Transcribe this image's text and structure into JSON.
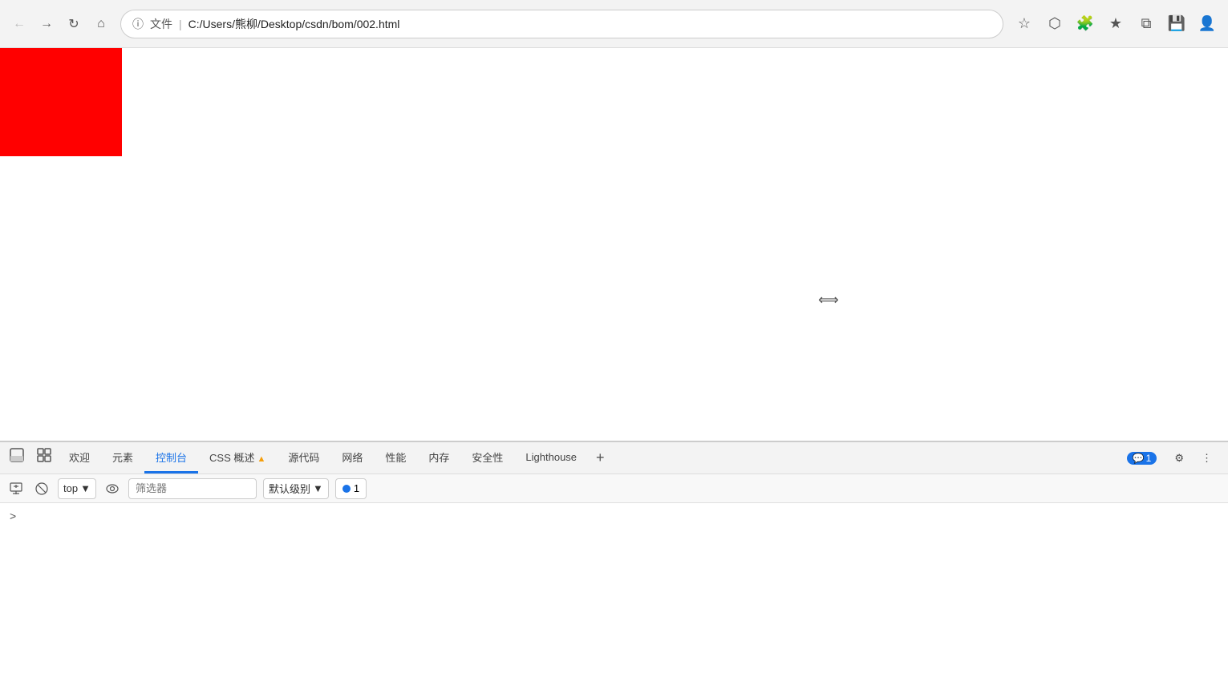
{
  "browser": {
    "back_disabled": true,
    "forward_label": "→",
    "back_label": "←",
    "refresh_label": "↻",
    "home_label": "⌂",
    "info_label": "ⓘ",
    "file_label": "文件",
    "separator": "|",
    "url": "C:/Users/熊柳/Desktop/csdn/bom/002.html",
    "star_icon": "☆",
    "extensions_icon": "⬡",
    "puzzle_icon": "🧩",
    "favorites_icon": "★",
    "collections_icon": "⧉",
    "save_icon": "💾",
    "profile_icon": "👤"
  },
  "page": {
    "red_box_color": "#ff0000"
  },
  "devtools": {
    "tabs": [
      {
        "label": "欢迎",
        "active": false,
        "warn": false
      },
      {
        "label": "元素",
        "active": false,
        "warn": false
      },
      {
        "label": "控制台",
        "active": true,
        "warn": false
      },
      {
        "label": "CSS 概述",
        "active": false,
        "warn": true
      },
      {
        "label": "源代码",
        "active": false,
        "warn": false
      },
      {
        "label": "网络",
        "active": false,
        "warn": false
      },
      {
        "label": "性能",
        "active": false,
        "warn": false
      },
      {
        "label": "内存",
        "active": false,
        "warn": false
      },
      {
        "label": "安全性",
        "active": false,
        "warn": false
      },
      {
        "label": "Lighthouse",
        "active": false,
        "warn": false
      }
    ],
    "add_tab_label": "+",
    "console_badge_count": "1",
    "settings_icon": "⚙",
    "more_icon": "⋮"
  },
  "console": {
    "clear_icon": "🚫",
    "top_label": "top",
    "eye_icon": "👁",
    "filter_placeholder": "筛选器",
    "default_level_label": "默认级别",
    "message_count": "1",
    "prompt_chevron": ">"
  }
}
